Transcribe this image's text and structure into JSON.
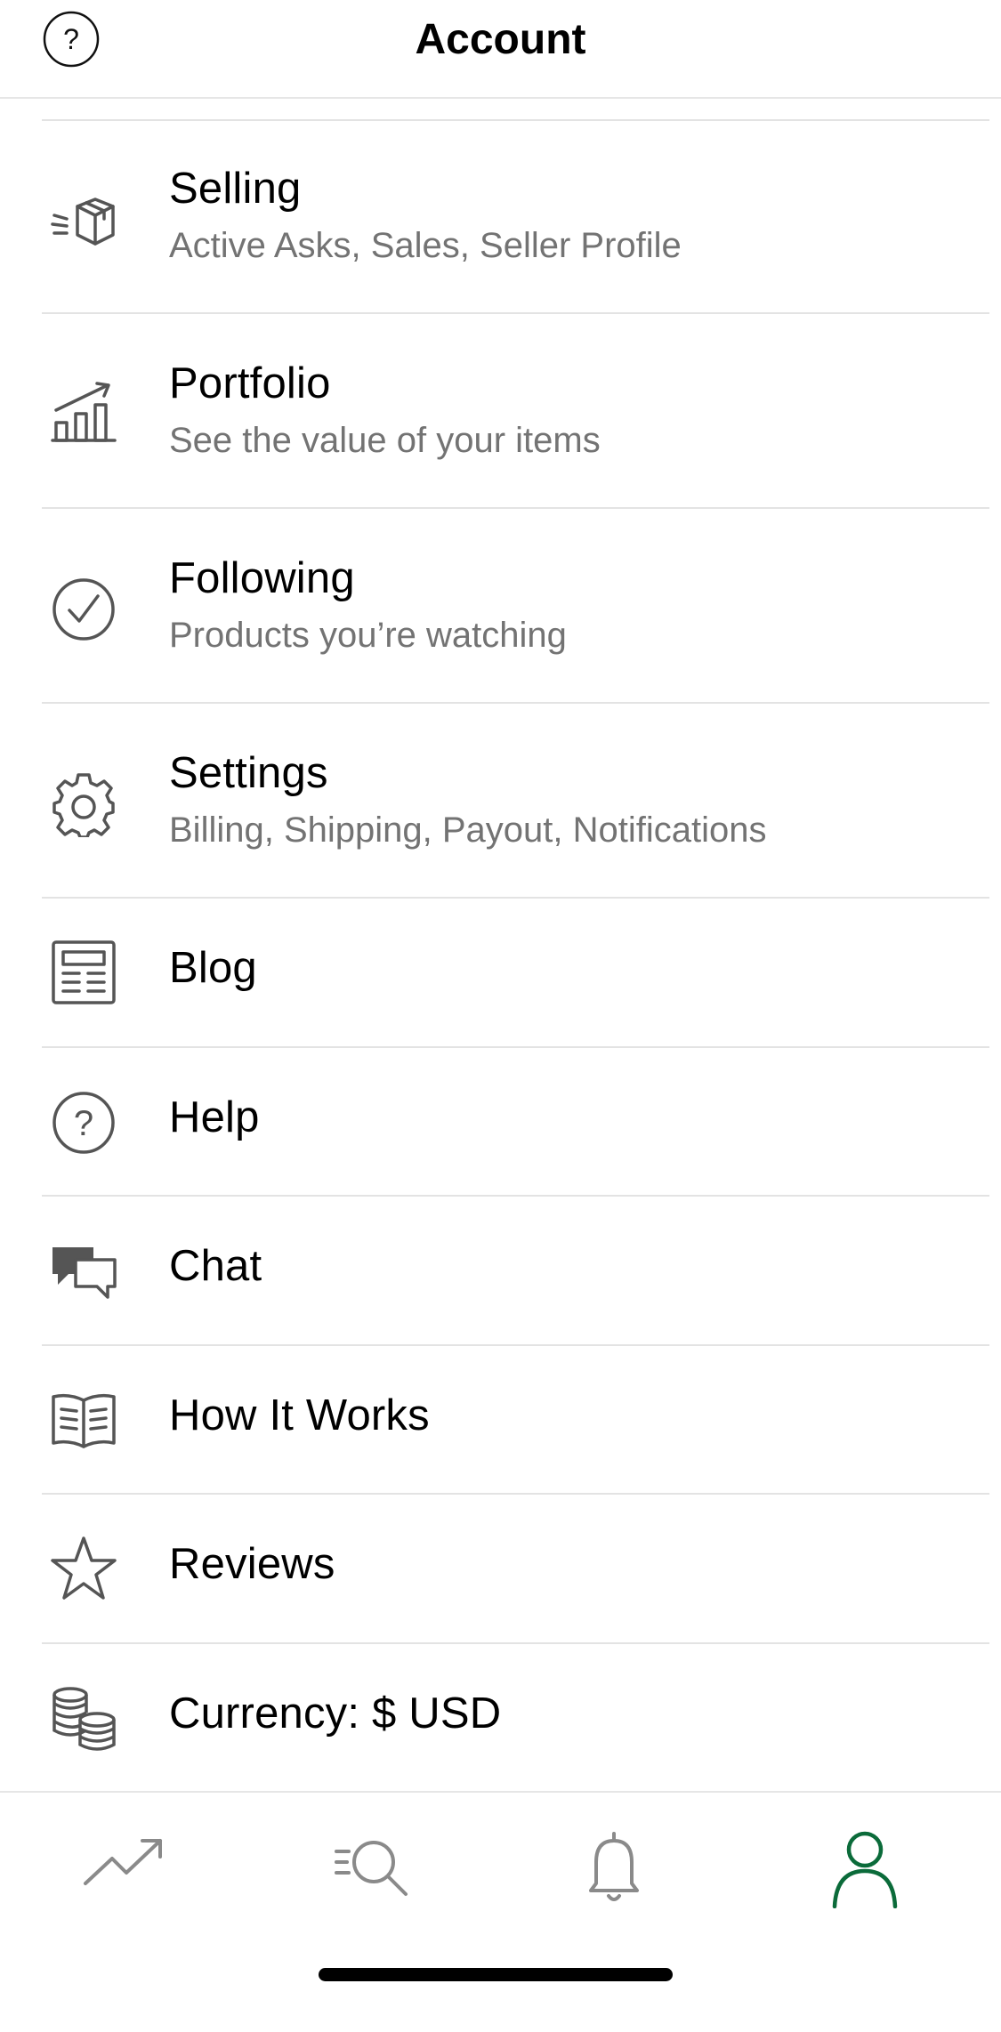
{
  "header": {
    "title": "Account",
    "help_icon": "question-circle-icon"
  },
  "menu": [
    {
      "id": "selling",
      "icon": "box-icon",
      "title": "Selling",
      "subtitle": "Active Asks, Sales, Seller Profile"
    },
    {
      "id": "portfolio",
      "icon": "chart-bars-icon",
      "title": "Portfolio",
      "subtitle": "See the value of your items"
    },
    {
      "id": "following",
      "icon": "check-circle-icon",
      "title": "Following",
      "subtitle": "Products you’re watching"
    },
    {
      "id": "settings",
      "icon": "gear-icon",
      "title": "Settings",
      "subtitle": "Billing, Shipping,  Payout, Notifications"
    },
    {
      "id": "blog",
      "icon": "newspaper-icon",
      "title": "Blog"
    },
    {
      "id": "help",
      "icon": "question-circle-icon",
      "title": "Help"
    },
    {
      "id": "chat",
      "icon": "chat-bubbles-icon",
      "title": "Chat"
    },
    {
      "id": "how-it-works",
      "icon": "open-book-icon",
      "title": "How It Works"
    },
    {
      "id": "reviews",
      "icon": "star-icon",
      "title": "Reviews"
    },
    {
      "id": "currency",
      "icon": "coins-icon",
      "title": "Currency: $ USD"
    }
  ],
  "tabbar": {
    "tabs": [
      {
        "id": "trending",
        "icon": "trending-up-icon",
        "active": false
      },
      {
        "id": "search",
        "icon": "search-icon",
        "active": false
      },
      {
        "id": "notifications",
        "icon": "bell-icon",
        "active": false
      },
      {
        "id": "account",
        "icon": "person-icon",
        "active": true
      }
    ],
    "active_color": "#0b6b3a",
    "inactive_color": "#8a8a8a"
  },
  "colors": {
    "icon": "#555555",
    "subtitle": "#737373",
    "divider": "#e3e3e3"
  }
}
